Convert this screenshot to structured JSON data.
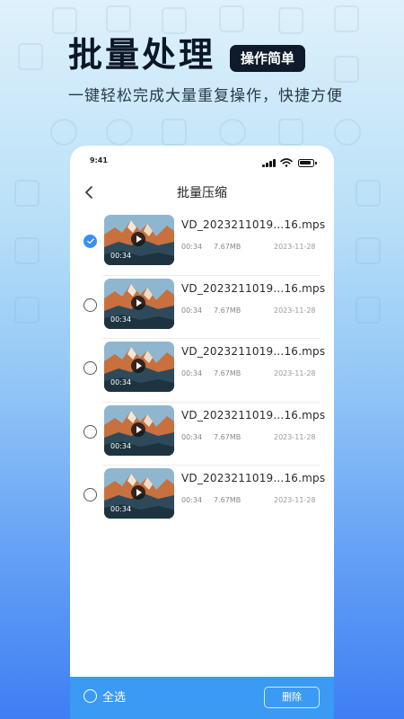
{
  "hero": {
    "title": "批量处理",
    "badge": "操作简单",
    "subtitle": "一键轻松完成大量重复操作，快捷方便"
  },
  "status_bar": {
    "time": "9:41"
  },
  "nav": {
    "title": "批量压缩"
  },
  "files": [
    {
      "name": "VD_2023211019...16.mps",
      "duration": "00:34",
      "size": "7.67MB",
      "date": "2023-11-28",
      "thumb_duration": "00:34",
      "checked": true
    },
    {
      "name": "VD_2023211019...16.mps",
      "duration": "00:34",
      "size": "7.67MB",
      "date": "2023-11-28",
      "thumb_duration": "00:34",
      "checked": false
    },
    {
      "name": "VD_2023211019...16.mps",
      "duration": "00:34",
      "size": "7.67MB",
      "date": "2023-11-28",
      "thumb_duration": "00:34",
      "checked": false
    },
    {
      "name": "VD_2023211019...16.mps",
      "duration": "00:34",
      "size": "7.67MB",
      "date": "2023-11-28",
      "thumb_duration": "00:34",
      "checked": false
    },
    {
      "name": "VD_2023211019...16.mps",
      "duration": "00:34",
      "size": "7.67MB",
      "date": "2023-11-28",
      "thumb_duration": "00:34",
      "checked": false
    }
  ],
  "bottom_bar": {
    "select_all_label": "全选",
    "delete_label": "删除"
  },
  "colors": {
    "accent": "#3b9af3",
    "checked": "#3a8ff2",
    "title": "#0b1626"
  },
  "icons": {
    "back": "chevron-left-icon",
    "play": "play-icon",
    "check": "check-icon"
  }
}
